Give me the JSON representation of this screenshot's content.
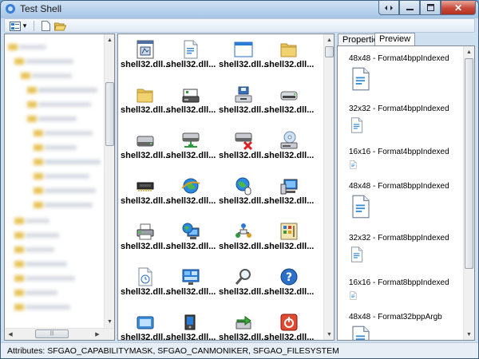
{
  "window": {
    "title": "Test Shell"
  },
  "caption": {
    "close_glyph": "✕"
  },
  "toolbar": {
    "items": [
      {
        "icon": "view-mode-icon"
      },
      {
        "icon": "dropdown-arrow-icon",
        "glyph": "▾"
      },
      {
        "icon": "new-item-icon"
      },
      {
        "icon": "open-folder-icon"
      }
    ]
  },
  "icon_grid": {
    "label": "shell32.dll...",
    "items": [
      {
        "icon": "system-dialog-icon"
      },
      {
        "icon": "document-icon"
      },
      {
        "icon": "window-icon"
      },
      {
        "icon": "folder-icon"
      },
      {
        "icon": "folder-icon"
      },
      {
        "icon": "disk-drive-icon"
      },
      {
        "icon": "floppy-drive-icon"
      },
      {
        "icon": "removable-drive-icon"
      },
      {
        "icon": "hard-drive-icon"
      },
      {
        "icon": "network-drive-icon"
      },
      {
        "icon": "disconnected-drive-icon"
      },
      {
        "icon": "cd-drive-icon"
      },
      {
        "icon": "memory-chip-icon"
      },
      {
        "icon": "internet-globe-icon"
      },
      {
        "icon": "globe-mouse-icon"
      },
      {
        "icon": "computer-icon"
      },
      {
        "icon": "printer-icon"
      },
      {
        "icon": "network-globe-icon"
      },
      {
        "icon": "network-people-icon"
      },
      {
        "icon": "control-grid-icon"
      },
      {
        "icon": "clock-document-icon"
      },
      {
        "icon": "control-panel-icon"
      },
      {
        "icon": "search-magnifier-icon"
      },
      {
        "icon": "help-icon"
      },
      {
        "icon": "run-icon"
      },
      {
        "icon": "log-off-icon"
      },
      {
        "icon": "export-arrow-icon"
      },
      {
        "icon": "power-icon"
      }
    ]
  },
  "tabs": [
    {
      "label": "Properties"
    },
    {
      "label": "Preview"
    }
  ],
  "preview": {
    "items": [
      {
        "label": "48x48 - Format4bppIndexed",
        "size": 48
      },
      {
        "label": "32x32 - Format4bppIndexed",
        "size": 32
      },
      {
        "label": "16x16 - Format4bppIndexed",
        "size": 16
      },
      {
        "label": "48x48 - Format8bppIndexed",
        "size": 48
      },
      {
        "label": "32x32 - Format8bppIndexed",
        "size": 32
      },
      {
        "label": "16x16 - Format8bppIndexed",
        "size": 16
      },
      {
        "label": "48x48 - Format32bppArgb",
        "size": 48
      }
    ]
  },
  "status": {
    "text": "Attributes: SFGAO_CAPABILITYMASK, SFGAO_CANMONIKER, SFGAO_FILESYSTEM"
  },
  "colors": {
    "folder": "#e6c255",
    "accent_blue": "#2a7ad8",
    "close_red": "#c8483a"
  }
}
